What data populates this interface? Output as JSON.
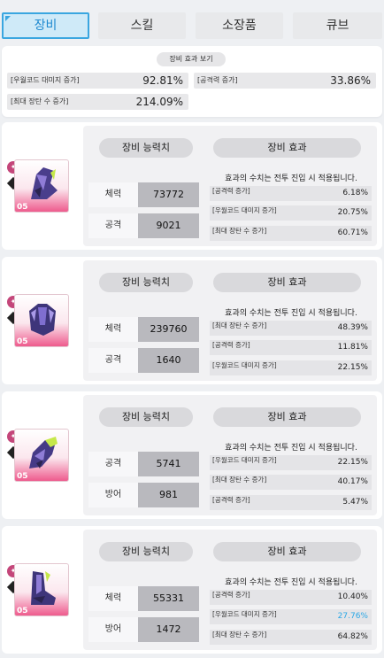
{
  "tabs": [
    {
      "label": "장비",
      "active": true
    },
    {
      "label": "스킬",
      "active": false
    },
    {
      "label": "소장품",
      "active": false
    },
    {
      "label": "큐브",
      "active": false
    }
  ],
  "summary": {
    "title": "장비 효과 보기",
    "rows": [
      {
        "label": "[우월코드 대미지 증가]",
        "value": "92.81%"
      },
      {
        "label": "[공격력 증가]",
        "value": "33.86%"
      },
      {
        "label": "[최대 장탄 수 증가]",
        "value": "214.09%"
      }
    ]
  },
  "labels": {
    "stats_header": "장비 능력치",
    "effects_header": "장비 효과",
    "effect_note": "효과의 수치는 전투 진입 시 적용됩니다."
  },
  "colors": {
    "accent": "#3aa6e0",
    "highlight_value": "#2aa7e6",
    "rarity": "#ee5b8d"
  },
  "equipment": [
    {
      "level": "05",
      "icon": "helmet-icon",
      "stats": [
        {
          "name": "체력",
          "value": "73772"
        },
        {
          "name": "공격",
          "value": "9021"
        }
      ],
      "effects": [
        {
          "label": "[공격력 증가]",
          "value": "6.18%"
        },
        {
          "label": "[우월코드 대미지 증가]",
          "value": "20.75%"
        },
        {
          "label": "[최대 장탄 수 증가]",
          "value": "60.71%"
        }
      ]
    },
    {
      "level": "05",
      "icon": "armor-icon",
      "stats": [
        {
          "name": "체력",
          "value": "239760"
        },
        {
          "name": "공격",
          "value": "1640"
        }
      ],
      "effects": [
        {
          "label": "[최대 장탄 수 증가]",
          "value": "48.39%"
        },
        {
          "label": "[공격력 증가]",
          "value": "11.81%"
        },
        {
          "label": "[우월코드 대미지 증가]",
          "value": "22.15%"
        }
      ]
    },
    {
      "level": "05",
      "icon": "gloves-icon",
      "stats": [
        {
          "name": "공격",
          "value": "5741"
        },
        {
          "name": "방어",
          "value": "981"
        }
      ],
      "effects": [
        {
          "label": "[우월코드 대미지 증가]",
          "value": "22.15%"
        },
        {
          "label": "[최대 장탄 수 증가]",
          "value": "40.17%"
        },
        {
          "label": "[공격력 증가]",
          "value": "5.47%"
        }
      ]
    },
    {
      "level": "05",
      "icon": "boots-icon",
      "stats": [
        {
          "name": "체력",
          "value": "55331"
        },
        {
          "name": "방어",
          "value": "1472"
        }
      ],
      "effects": [
        {
          "label": "[공격력 증가]",
          "value": "10.40%"
        },
        {
          "label": "[우월코드 대미지 증가]",
          "value": "27.76%",
          "highlight": true
        },
        {
          "label": "[최대 장탄 수 증가]",
          "value": "64.82%"
        }
      ]
    }
  ]
}
